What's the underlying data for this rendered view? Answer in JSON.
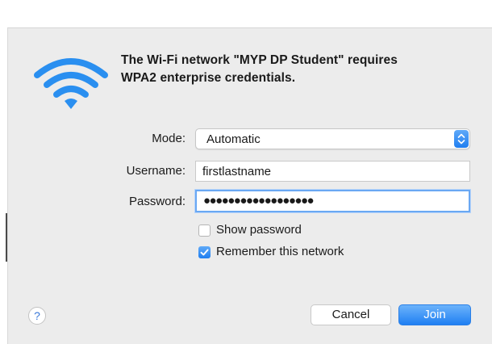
{
  "dialog": {
    "title_line1": "The Wi-Fi network \"MYP DP Student\" requires",
    "title_line2": "WPA2 enterprise credentials."
  },
  "form": {
    "mode_label": "Mode:",
    "mode_value": "Automatic",
    "username_label": "Username:",
    "username_value": "firstlastname",
    "password_label": "Password:",
    "password_masked": "●●●●●●●●●●●●●●●●●●"
  },
  "options": {
    "show_password_label": "Show password",
    "show_password_checked": false,
    "remember_label": "Remember this network",
    "remember_checked": true
  },
  "buttons": {
    "help": "?",
    "cancel": "Cancel",
    "join": "Join"
  },
  "icons": {
    "wifi": "wifi-icon",
    "stepper": "chevron-up-down-icon",
    "checkmark": "checkmark-icon"
  },
  "colors": {
    "accent": "#2a84f3",
    "dialog_bg": "#ececec"
  }
}
